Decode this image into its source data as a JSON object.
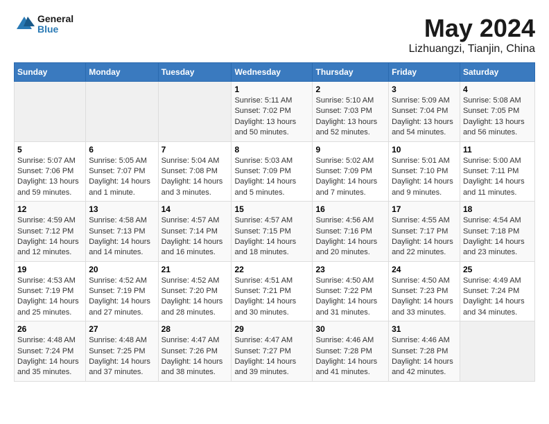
{
  "logo": {
    "line1": "General",
    "line2": "Blue"
  },
  "title": "May 2024",
  "subtitle": "Lizhuangzi, Tianjin, China",
  "weekdays": [
    "Sunday",
    "Monday",
    "Tuesday",
    "Wednesday",
    "Thursday",
    "Friday",
    "Saturday"
  ],
  "weeks": [
    [
      {
        "day": "",
        "sunrise": "",
        "sunset": "",
        "daylight": ""
      },
      {
        "day": "",
        "sunrise": "",
        "sunset": "",
        "daylight": ""
      },
      {
        "day": "",
        "sunrise": "",
        "sunset": "",
        "daylight": ""
      },
      {
        "day": "1",
        "sunrise": "Sunrise: 5:11 AM",
        "sunset": "Sunset: 7:02 PM",
        "daylight": "Daylight: 13 hours and 50 minutes."
      },
      {
        "day": "2",
        "sunrise": "Sunrise: 5:10 AM",
        "sunset": "Sunset: 7:03 PM",
        "daylight": "Daylight: 13 hours and 52 minutes."
      },
      {
        "day": "3",
        "sunrise": "Sunrise: 5:09 AM",
        "sunset": "Sunset: 7:04 PM",
        "daylight": "Daylight: 13 hours and 54 minutes."
      },
      {
        "day": "4",
        "sunrise": "Sunrise: 5:08 AM",
        "sunset": "Sunset: 7:05 PM",
        "daylight": "Daylight: 13 hours and 56 minutes."
      }
    ],
    [
      {
        "day": "5",
        "sunrise": "Sunrise: 5:07 AM",
        "sunset": "Sunset: 7:06 PM",
        "daylight": "Daylight: 13 hours and 59 minutes."
      },
      {
        "day": "6",
        "sunrise": "Sunrise: 5:05 AM",
        "sunset": "Sunset: 7:07 PM",
        "daylight": "Daylight: 14 hours and 1 minute."
      },
      {
        "day": "7",
        "sunrise": "Sunrise: 5:04 AM",
        "sunset": "Sunset: 7:08 PM",
        "daylight": "Daylight: 14 hours and 3 minutes."
      },
      {
        "day": "8",
        "sunrise": "Sunrise: 5:03 AM",
        "sunset": "Sunset: 7:09 PM",
        "daylight": "Daylight: 14 hours and 5 minutes."
      },
      {
        "day": "9",
        "sunrise": "Sunrise: 5:02 AM",
        "sunset": "Sunset: 7:09 PM",
        "daylight": "Daylight: 14 hours and 7 minutes."
      },
      {
        "day": "10",
        "sunrise": "Sunrise: 5:01 AM",
        "sunset": "Sunset: 7:10 PM",
        "daylight": "Daylight: 14 hours and 9 minutes."
      },
      {
        "day": "11",
        "sunrise": "Sunrise: 5:00 AM",
        "sunset": "Sunset: 7:11 PM",
        "daylight": "Daylight: 14 hours and 11 minutes."
      }
    ],
    [
      {
        "day": "12",
        "sunrise": "Sunrise: 4:59 AM",
        "sunset": "Sunset: 7:12 PM",
        "daylight": "Daylight: 14 hours and 12 minutes."
      },
      {
        "day": "13",
        "sunrise": "Sunrise: 4:58 AM",
        "sunset": "Sunset: 7:13 PM",
        "daylight": "Daylight: 14 hours and 14 minutes."
      },
      {
        "day": "14",
        "sunrise": "Sunrise: 4:57 AM",
        "sunset": "Sunset: 7:14 PM",
        "daylight": "Daylight: 14 hours and 16 minutes."
      },
      {
        "day": "15",
        "sunrise": "Sunrise: 4:57 AM",
        "sunset": "Sunset: 7:15 PM",
        "daylight": "Daylight: 14 hours and 18 minutes."
      },
      {
        "day": "16",
        "sunrise": "Sunrise: 4:56 AM",
        "sunset": "Sunset: 7:16 PM",
        "daylight": "Daylight: 14 hours and 20 minutes."
      },
      {
        "day": "17",
        "sunrise": "Sunrise: 4:55 AM",
        "sunset": "Sunset: 7:17 PM",
        "daylight": "Daylight: 14 hours and 22 minutes."
      },
      {
        "day": "18",
        "sunrise": "Sunrise: 4:54 AM",
        "sunset": "Sunset: 7:18 PM",
        "daylight": "Daylight: 14 hours and 23 minutes."
      }
    ],
    [
      {
        "day": "19",
        "sunrise": "Sunrise: 4:53 AM",
        "sunset": "Sunset: 7:19 PM",
        "daylight": "Daylight: 14 hours and 25 minutes."
      },
      {
        "day": "20",
        "sunrise": "Sunrise: 4:52 AM",
        "sunset": "Sunset: 7:19 PM",
        "daylight": "Daylight: 14 hours and 27 minutes."
      },
      {
        "day": "21",
        "sunrise": "Sunrise: 4:52 AM",
        "sunset": "Sunset: 7:20 PM",
        "daylight": "Daylight: 14 hours and 28 minutes."
      },
      {
        "day": "22",
        "sunrise": "Sunrise: 4:51 AM",
        "sunset": "Sunset: 7:21 PM",
        "daylight": "Daylight: 14 hours and 30 minutes."
      },
      {
        "day": "23",
        "sunrise": "Sunrise: 4:50 AM",
        "sunset": "Sunset: 7:22 PM",
        "daylight": "Daylight: 14 hours and 31 minutes."
      },
      {
        "day": "24",
        "sunrise": "Sunrise: 4:50 AM",
        "sunset": "Sunset: 7:23 PM",
        "daylight": "Daylight: 14 hours and 33 minutes."
      },
      {
        "day": "25",
        "sunrise": "Sunrise: 4:49 AM",
        "sunset": "Sunset: 7:24 PM",
        "daylight": "Daylight: 14 hours and 34 minutes."
      }
    ],
    [
      {
        "day": "26",
        "sunrise": "Sunrise: 4:48 AM",
        "sunset": "Sunset: 7:24 PM",
        "daylight": "Daylight: 14 hours and 35 minutes."
      },
      {
        "day": "27",
        "sunrise": "Sunrise: 4:48 AM",
        "sunset": "Sunset: 7:25 PM",
        "daylight": "Daylight: 14 hours and 37 minutes."
      },
      {
        "day": "28",
        "sunrise": "Sunrise: 4:47 AM",
        "sunset": "Sunset: 7:26 PM",
        "daylight": "Daylight: 14 hours and 38 minutes."
      },
      {
        "day": "29",
        "sunrise": "Sunrise: 4:47 AM",
        "sunset": "Sunset: 7:27 PM",
        "daylight": "Daylight: 14 hours and 39 minutes."
      },
      {
        "day": "30",
        "sunrise": "Sunrise: 4:46 AM",
        "sunset": "Sunset: 7:28 PM",
        "daylight": "Daylight: 14 hours and 41 minutes."
      },
      {
        "day": "31",
        "sunrise": "Sunrise: 4:46 AM",
        "sunset": "Sunset: 7:28 PM",
        "daylight": "Daylight: 14 hours and 42 minutes."
      },
      {
        "day": "",
        "sunrise": "",
        "sunset": "",
        "daylight": ""
      }
    ]
  ]
}
